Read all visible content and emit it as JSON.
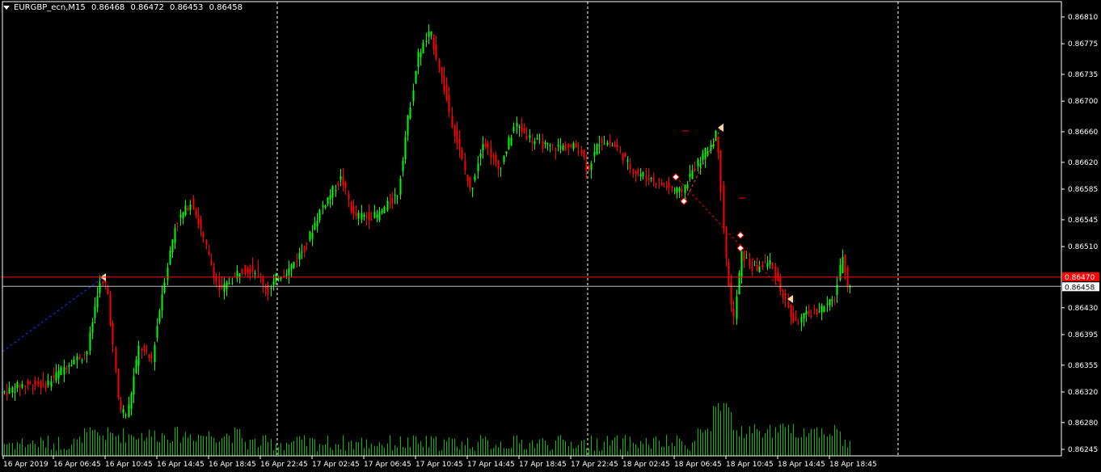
{
  "header": {
    "symbol": "EURGBP_ecn,M15",
    "open": "0.86468",
    "high": "0.86472",
    "low": "0.86453",
    "close": "0.86458"
  },
  "colors": {
    "background": "#000000",
    "frame": "#ffffff",
    "bull": "#00ff00",
    "bear": "#ff0000",
    "text": "#ffffff",
    "bid_line": "#ff0000",
    "ask_line": "#c0c0c0",
    "volume": "#00c000",
    "price_tag_red": "#ff0000",
    "price_tag_white": "#ffffff"
  },
  "y_axis_labels": [
    "0.86810",
    "0.86775",
    "0.86735",
    "0.86700",
    "0.86660",
    "0.86620",
    "0.86585",
    "0.86545",
    "0.86510",
    "0.86430",
    "0.86395",
    "0.86355",
    "0.86320",
    "0.86280",
    "0.86245"
  ],
  "x_axis_labels": [
    "16 Apr 2019",
    "16 Apr 06:45",
    "16 Apr 10:45",
    "16 Apr 14:45",
    "16 Apr 18:45",
    "16 Apr 22:45",
    "17 Apr 02:45",
    "17 Apr 06:45",
    "17 Apr 10:45",
    "17 Apr 14:45",
    "17 Apr 18:45",
    "17 Apr 22:45",
    "18 Apr 02:45",
    "18 Apr 06:45",
    "18 Apr 10:45",
    "18 Apr 14:45",
    "18 Apr 18:45"
  ],
  "price_tags": {
    "ask": "0.86470",
    "bid": "0.86458"
  },
  "chart_data": {
    "type": "candlestick",
    "timeframe": "M15",
    "ylim": [
      0.86245,
      0.8683
    ],
    "key_points": [
      {
        "time": "16 Apr 2019",
        "price": 0.8632
      },
      {
        "time": "16 Apr 06:45",
        "price": 0.8646
      },
      {
        "time": "16 Apr 10:45",
        "price": 0.8628
      },
      {
        "time": "16 Apr 14:45",
        "price": 0.8656
      },
      {
        "time": "16 Apr 18:45",
        "price": 0.8646
      },
      {
        "time": "16 Apr 22:45",
        "price": 0.8646
      },
      {
        "time": "17 Apr 02:45",
        "price": 0.8653
      },
      {
        "time": "17 Apr 06:45",
        "price": 0.8656
      },
      {
        "time": "17 Apr 10:45",
        "price": 0.868
      },
      {
        "time": "17 Apr 14:45",
        "price": 0.8662
      },
      {
        "time": "17 Apr 18:45",
        "price": 0.8666
      },
      {
        "time": "17 Apr 22:45",
        "price": 0.8664
      },
      {
        "time": "18 Apr 02:45",
        "price": 0.8661
      },
      {
        "time": "18 Apr 06:45",
        "price": 0.8664
      },
      {
        "time": "18 Apr 10:45",
        "price": 0.8652
      },
      {
        "time": "18 Apr 14:45",
        "price": 0.8643
      },
      {
        "time": "18 Apr 18:45",
        "price": 0.86458
      }
    ]
  }
}
